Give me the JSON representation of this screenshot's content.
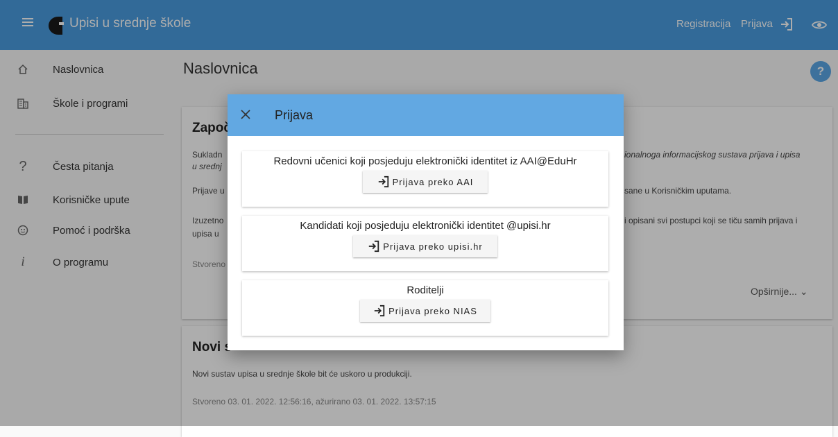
{
  "header": {
    "app_title": "Upisi u srednje škole",
    "register_label": "Registracija",
    "login_label": "Prijava",
    "bar_color": "#4a9de0"
  },
  "sidebar": {
    "items": [
      {
        "label": "Naslovnica",
        "icon": "home-icon"
      },
      {
        "label": "Škole i programi",
        "icon": "building-icon"
      },
      {
        "label": "Česta pitanja",
        "icon": "question-icon"
      },
      {
        "label": "Korisničke upute",
        "icon": "book-icon"
      },
      {
        "label": "Pomoć i podrška",
        "icon": "support-icon"
      },
      {
        "label": "O programu",
        "icon": "info-icon"
      }
    ]
  },
  "main": {
    "page_title": "Naslovnica",
    "help_label": "?",
    "card1": {
      "title": "Započ",
      "line1a": "Sukladn",
      "line1b": "u srednj",
      "line1_right": "ionalnoga informacijskog sustava prijava i upisa",
      "line2a": "Prijave u",
      "line2_right": "sane u Korisničkim uputama.",
      "line3a": "Izuzetno",
      "line3b": "upisa u",
      "line3_right": "i opisani svi postupci koji se tiču samih prijava i",
      "meta": "Stvoreno",
      "more_label": "Opširnije...",
      "more_icon": "chevron-down-icon"
    },
    "card2": {
      "title": "Novi s",
      "text": "Novi sustav upisa u srednje škole bit će uskoro u produkciji.",
      "meta": "Stvoreno 03. 01. 2022. 12:56:16, ažurirano 03. 01. 2022. 13:57:15"
    }
  },
  "dialog": {
    "title": "Prijava",
    "header_color": "#62a8e2",
    "options": [
      {
        "text": "Redovni učenici koji posjeduju elektronički identitet iz AAI@EduHr",
        "button": "Prijava preko AAI"
      },
      {
        "text": "Kandidati koji posjeduju elektronički identitet @upisi.hr",
        "button": "Prijava preko upisi.hr"
      },
      {
        "text": "Roditelji",
        "button": "Prijava preko NIAS"
      }
    ]
  }
}
